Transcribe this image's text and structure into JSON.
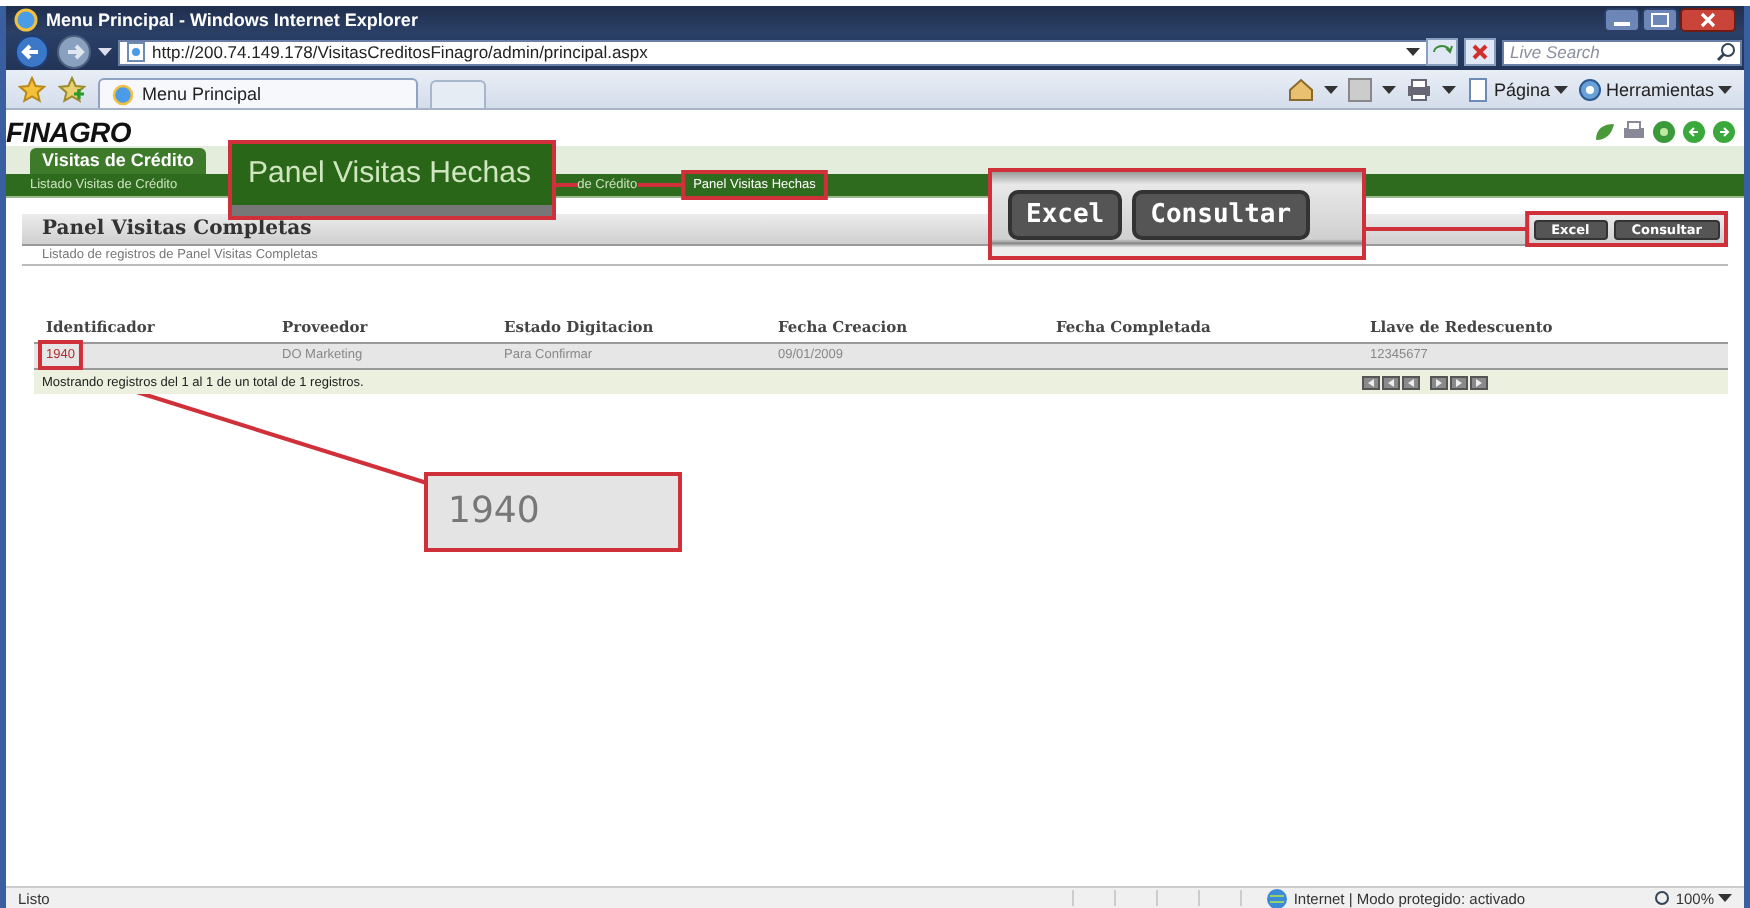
{
  "window": {
    "title": "Menu Principal - Windows Internet Explorer"
  },
  "address_bar": {
    "url": "http://200.74.149.178/VisitasCreditosFinagro/admin/principal.aspx",
    "search_placeholder": "Live Search"
  },
  "tab_bar": {
    "tabs": [
      {
        "label": "Menu Principal",
        "selected": true
      }
    ],
    "commands": [
      "Página",
      "Herramientas"
    ]
  },
  "page": {
    "logo": "FINAGRO",
    "menu_tab": "Visitas de Crédito",
    "submenu": [
      "Listado Visitas de Crédito",
      "de Crédito",
      "Panel Visitas Hechas"
    ],
    "panel": {
      "title": "Panel Visitas Completas",
      "subtitle": "Listado de registros de Panel Visitas Completas",
      "buttons": [
        "Excel",
        "Consultar"
      ]
    },
    "table": {
      "columns": [
        "Identificador",
        "Proveedor",
        "Estado Digitacion",
        "Fecha Creacion",
        "Fecha Completada",
        "Llave de Redescuento"
      ],
      "rows": [
        [
          "1940",
          "DO Marketing",
          "Para Confirmar",
          "09/01/2009",
          "",
          "12345677"
        ]
      ],
      "footer": "Mostrando registros del 1 al 1 de un total de 1 registros."
    }
  },
  "callouts": [
    {
      "kind": "menu",
      "text": "Panel Visitas Hechas"
    },
    {
      "kind": "buttons",
      "labels": [
        "Excel",
        "Consultar"
      ]
    },
    {
      "kind": "cell",
      "text": "1940"
    }
  ],
  "status_bar": {
    "text": "Listo",
    "zone": "Internet | Modo protegido: activado",
    "zoom": "100%"
  }
}
